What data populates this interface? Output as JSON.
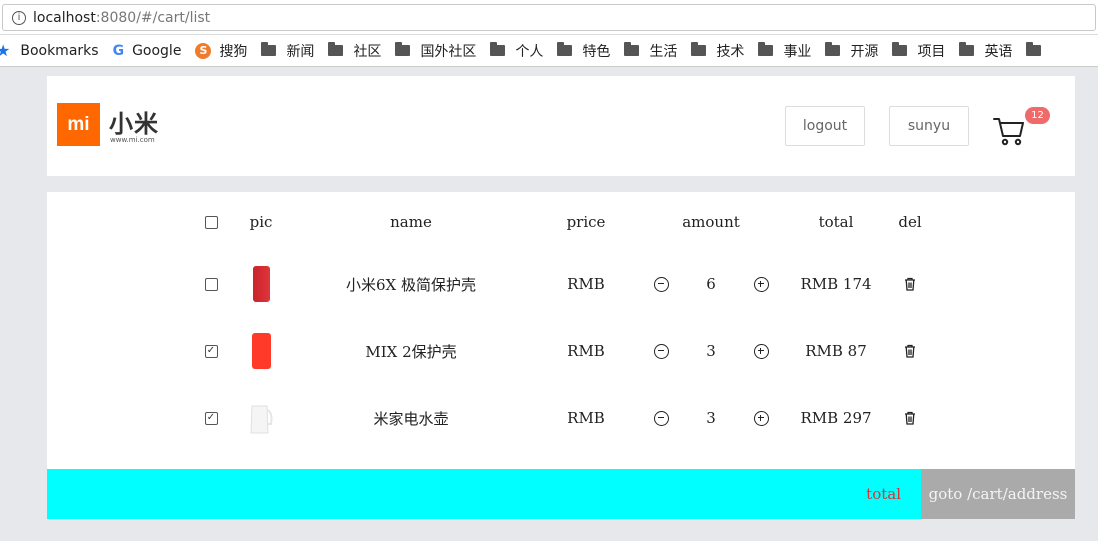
{
  "browser": {
    "url_host": "localhost",
    "url_rest": ":8080/#/cart/list",
    "bookmarks": [
      {
        "label": "Bookmarks",
        "icon": "star-icon"
      },
      {
        "label": "Google",
        "icon": "google-icon"
      },
      {
        "label": "搜狗",
        "icon": "sogou-icon"
      },
      {
        "label": "新闻",
        "icon": "folder-icon"
      },
      {
        "label": "社区",
        "icon": "folder-icon"
      },
      {
        "label": "国外社区",
        "icon": "folder-icon"
      },
      {
        "label": "个人",
        "icon": "folder-icon"
      },
      {
        "label": "特色",
        "icon": "folder-icon"
      },
      {
        "label": "生活",
        "icon": "folder-icon"
      },
      {
        "label": "技术",
        "icon": "folder-icon"
      },
      {
        "label": "事业",
        "icon": "folder-icon"
      },
      {
        "label": "开源",
        "icon": "folder-icon"
      },
      {
        "label": "项目",
        "icon": "folder-icon"
      },
      {
        "label": "英语",
        "icon": "folder-icon"
      }
    ]
  },
  "header": {
    "logo_mark": "mi",
    "logo_text": "小米",
    "logo_sub": "www.mi.com",
    "logout_label": "logout",
    "user_label": "sunyu",
    "cart_count": "12",
    "brand_color": "#ff6700"
  },
  "cart": {
    "columns": {
      "pic": "pic",
      "name": "name",
      "price": "price",
      "amount": "amount",
      "total": "total",
      "del": "del"
    },
    "select_all_checked": false,
    "items": [
      {
        "name": "小米6X 极简保护壳",
        "price": "RMB",
        "amount": "6",
        "total": "RMB 174",
        "checked": false,
        "thumb": "red-phone-case"
      },
      {
        "name": "MIX 2保护壳",
        "price": "RMB",
        "amount": "3",
        "total": "RMB 87",
        "checked": true,
        "thumb": "red-phone-case"
      },
      {
        "name": "米家电水壶",
        "price": "RMB",
        "amount": "3",
        "total": "RMB 297",
        "checked": true,
        "thumb": "white-kettle"
      }
    ],
    "footer_total_label": "total",
    "goto_label": "goto /cart/address",
    "footer_color": "#00ffff"
  }
}
